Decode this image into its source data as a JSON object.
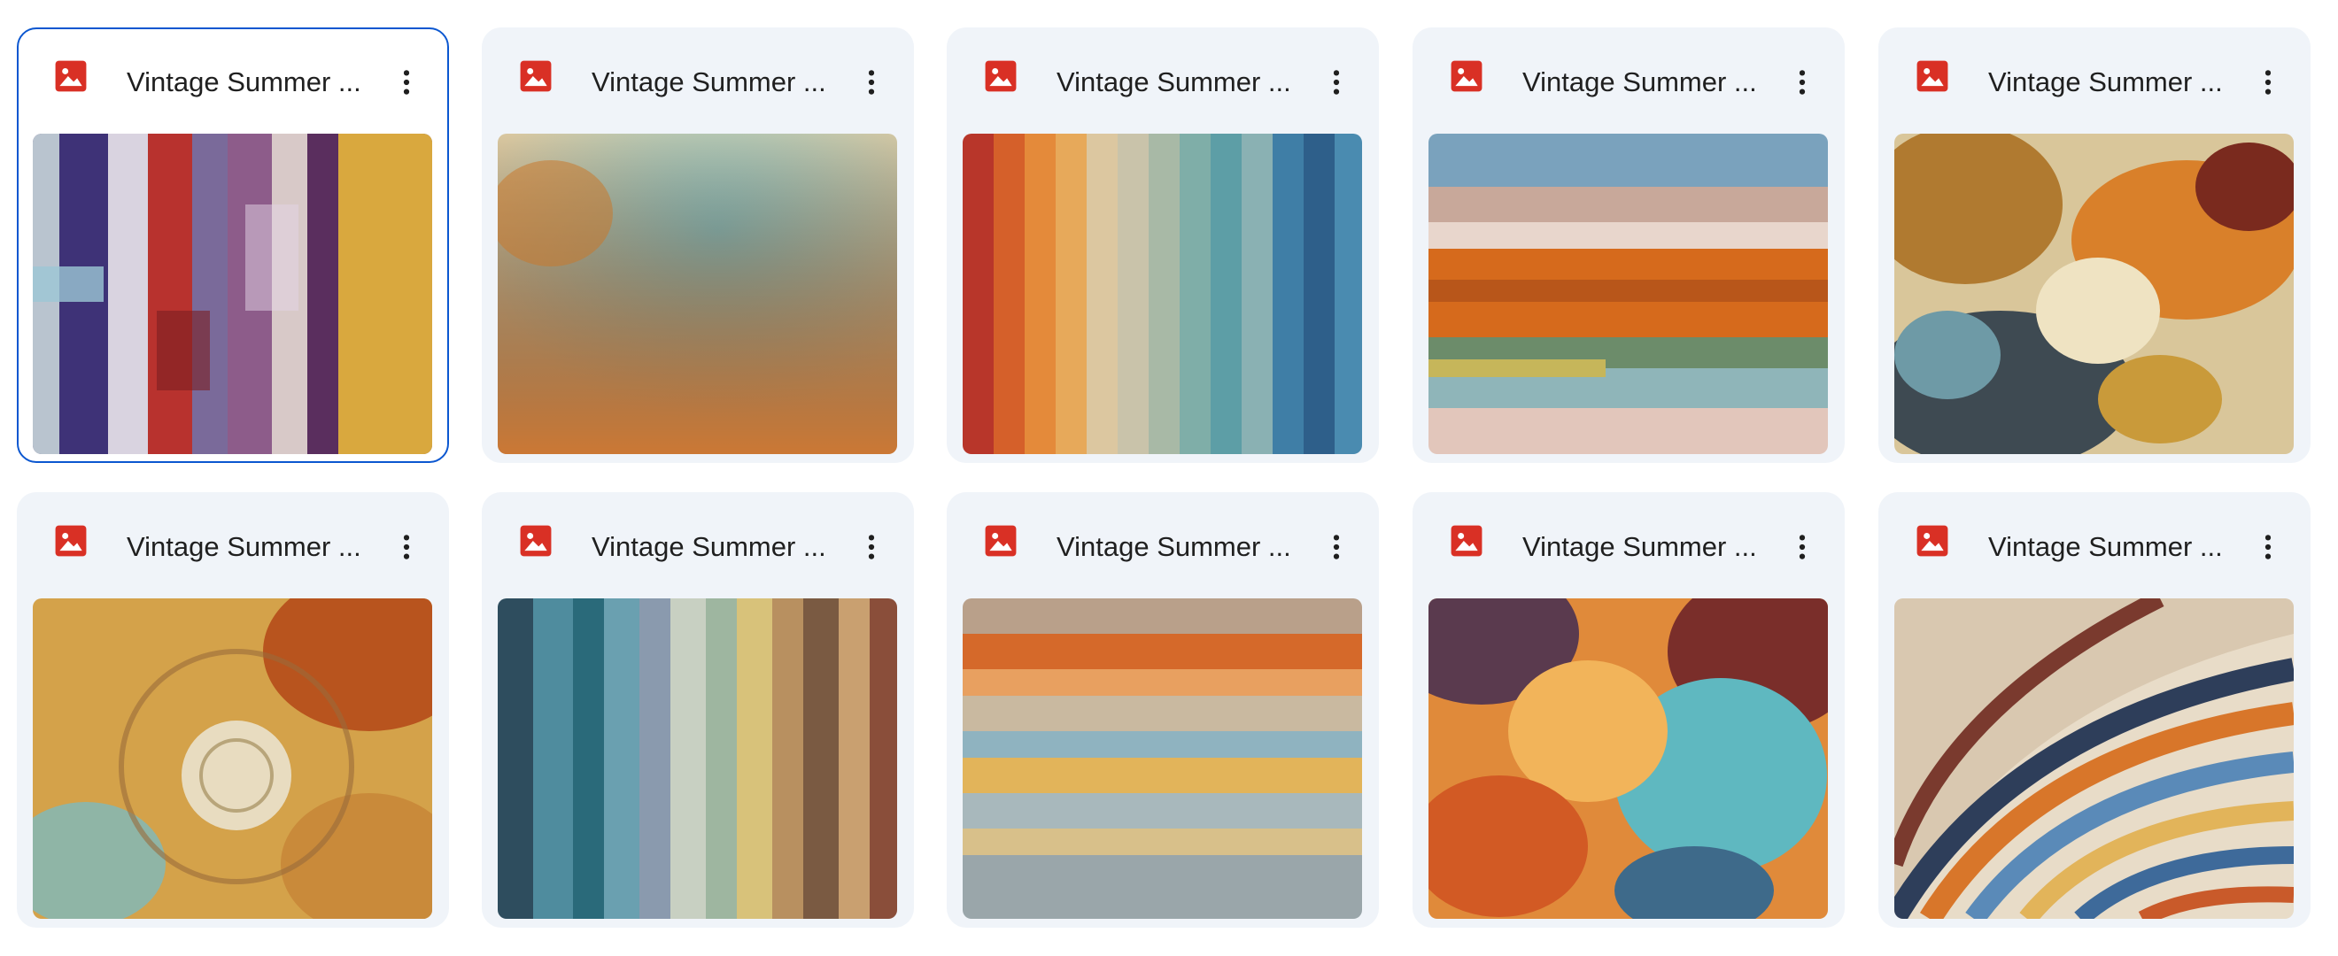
{
  "files": [
    {
      "name": "Vintage Summer ...",
      "thumbnail": "violet-red-ochre-vertical-peeling-paint",
      "selected": true
    },
    {
      "name": "Vintage Summer ...",
      "thumbnail": "teal-cream-orange-grunge-texture"
    },
    {
      "name": "Vintage Summer ...",
      "thumbnail": "rainbow-vertical-tiles"
    },
    {
      "name": "Vintage Summer ...",
      "thumbnail": "horizontal-peeling-blue-orange-paint"
    },
    {
      "name": "Vintage Summer ...",
      "thumbnail": "gold-rust-abstract-splash"
    },
    {
      "name": "Vintage Summer ...",
      "thumbnail": "swirl-sun-impasto"
    },
    {
      "name": "Vintage Summer ...",
      "thumbnail": "teal-brown-vertical-drips"
    },
    {
      "name": "Vintage Summer ...",
      "thumbnail": "horizontal-sunset-stripes"
    },
    {
      "name": "Vintage Summer ...",
      "thumbnail": "orange-teal-mosaic-burst"
    },
    {
      "name": "Vintage Summer ...",
      "thumbnail": "curved-mosaic-fan"
    }
  ],
  "icons": {
    "file_type": "image-file-icon",
    "more": "more-vert-icon"
  },
  "colors": {
    "file_icon": "#d93025",
    "selection_border": "#0b57d0",
    "card_bg": "#f0f4f9",
    "title_text": "#1f1f1f"
  }
}
